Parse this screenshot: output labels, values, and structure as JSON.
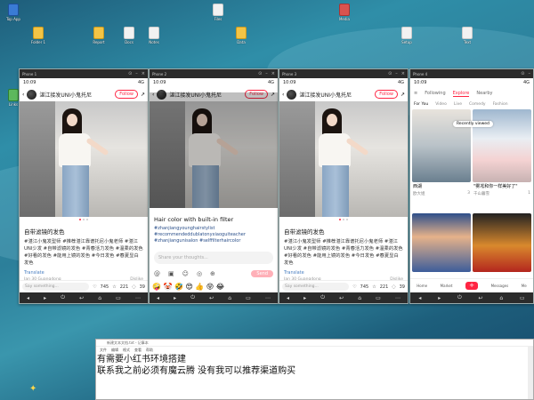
{
  "desktop": {
    "icons": [
      {
        "label": "Top App",
        "color": "b"
      },
      {
        "label": "Folder 1",
        "color": "y"
      },
      {
        "label": "Report",
        "color": "y"
      },
      {
        "label": "Docs",
        "color": ""
      },
      {
        "label": "Notes",
        "color": ""
      },
      {
        "label": "Files",
        "color": ""
      },
      {
        "label": "Data",
        "color": "y"
      },
      {
        "label": "Setup",
        "color": ""
      },
      {
        "label": "Text",
        "color": ""
      },
      {
        "label": "Media",
        "color": "r"
      },
      {
        "label": "Links",
        "color": "g"
      }
    ]
  },
  "phone1": {
    "window_title": "Phone 1",
    "time": "10:09",
    "signal": "4G",
    "author": "湛江接发UNI小鬼托尼",
    "follow": "Follow",
    "post_title": "自带滤镜的发色",
    "post_body": "#湛江小鬼发型师 #推荐湛江靠谱托尼小鬼老师 #湛江UNI少发 #自带滤镜的发色 #青春活力发色 #温柔的发色 #好看的发色 #能用上镜的发色 #今日发色 #春夏显白发色",
    "translate": "Translate",
    "date": "Jan 30 Guangdong",
    "dislike": "Dislike",
    "say": "Say something...",
    "likes": "745",
    "stars": "221",
    "comments": "39"
  },
  "phone2": {
    "window_title": "Phone 2",
    "time": "10:09",
    "signal": "4G",
    "author": "湛江接发UNI小鬼托尼",
    "follow": "Follow",
    "sheet_title": "Hair color with built-in filter",
    "sheet_tags": "#zhanjiangyounghairstylist #recommendeddublatonyxiaoguiteacher #zhanjiangunisalon #selffilterhaircolor",
    "input_placeholder": "Share your thoughts...",
    "send": "Send",
    "emojis": "🤪 🤡 🤣 😍 👍 😝 😂"
  },
  "phone3": {
    "window_title": "Phone 3",
    "time": "10:09",
    "signal": "4G",
    "author": "湛江接发UNI小鬼托尼",
    "follow": "Follow",
    "post_title": "自带滤镜的发色",
    "post_body": "#湛江小鬼发型师 #推荐湛江靠谱托尼小鬼老师 #湛江UNI少发 #自带滤镜的发色 #青春活力发色 #温柔的发色 #好看的发色 #能用上镜的发色 #今日发色 #春夏显白发色",
    "translate": "Translate",
    "date": "Jan 30 Guangdong",
    "dislike": "Dislike",
    "say": "Say something...",
    "likes": "745",
    "stars": "221",
    "comments": "39"
  },
  "phone4": {
    "window_title": "Phone 4",
    "time": "10:09",
    "signal": "4G",
    "tabs": [
      "Following",
      "Explore",
      "Nearby"
    ],
    "subtabs": [
      "For You",
      "Video",
      "Live",
      "Comedy",
      "Fashion"
    ],
    "bubble": "Recently viewed",
    "cards": [
      {
        "caption": "西湖",
        "user": "欧大姐",
        "likes": "3"
      },
      {
        "caption": "\"雾凇和你一样美好了\"",
        "user": "千山暮雪",
        "likes": "1"
      },
      {
        "caption": "",
        "user": "",
        "likes": ""
      },
      {
        "caption": "",
        "user": "",
        "likes": ""
      }
    ],
    "nav": [
      "Home",
      "Market",
      "+",
      "Messages",
      "Me"
    ]
  },
  "notepad": {
    "title": "新建文本文档.txt - 记事本",
    "menu": [
      "文件",
      "编辑",
      "格式",
      "查看",
      "帮助"
    ],
    "line1": "有需要小红书环境搭建",
    "line2": "联系我之前必须有魔云腾 没有我可以推荐渠道购买"
  }
}
